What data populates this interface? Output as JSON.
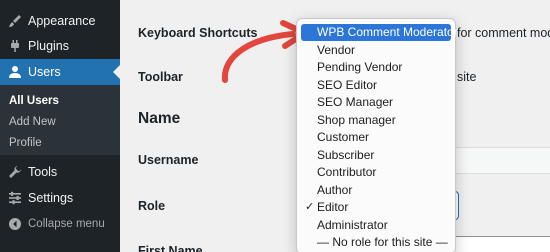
{
  "sidebar": {
    "items": [
      {
        "label": "Appearance",
        "icon": "paintbrush-icon"
      },
      {
        "label": "Plugins",
        "icon": "plug-icon"
      },
      {
        "label": "Users",
        "icon": "user-icon",
        "active": true
      },
      {
        "label": "Tools",
        "icon": "wrench-icon"
      },
      {
        "label": "Settings",
        "icon": "settings-icon"
      },
      {
        "label": "Collapse menu",
        "icon": "collapse-arrow-icon"
      }
    ],
    "submenu": [
      "All Users",
      "Add New",
      "Profile"
    ],
    "colors": {
      "background": "#1d2327",
      "active": "#2271b1",
      "submenu": "#2c3338"
    }
  },
  "form": {
    "keyboard_shortcuts_label": "Keyboard Shortcuts",
    "keyboard_shortcuts_text_fragment": "for comment moder",
    "toolbar_label": "Toolbar",
    "toolbar_text_fragment": "site",
    "name_heading": "Name",
    "username_label": "Username",
    "role_label": "Role",
    "first_name_label": "First Name"
  },
  "role_dropdown": {
    "highlighted": "WPB Comment Moderator",
    "selected": "Editor",
    "options": [
      "WPB Comment Moderator",
      "Vendor",
      "Pending Vendor",
      "SEO Editor",
      "SEO Manager",
      "Shop manager",
      "Customer",
      "Subscriber",
      "Contributor",
      "Author",
      "Editor",
      "Administrator",
      "— No role for this site —"
    ],
    "check_mark": "✓",
    "highlight_color": "#2d76d8"
  },
  "annotation": {
    "arrow_color": "#e2463c"
  }
}
